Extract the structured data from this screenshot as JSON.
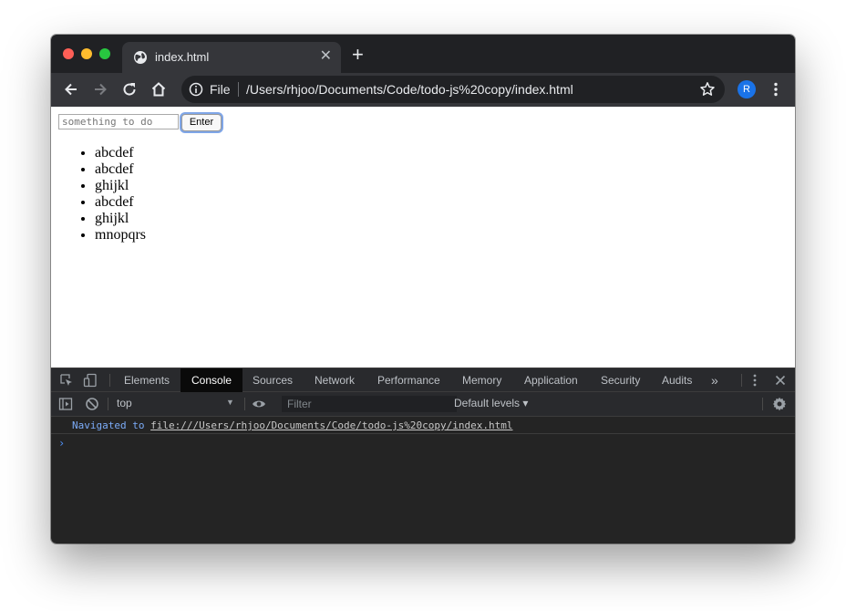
{
  "browser": {
    "tab": {
      "title": "index.html"
    },
    "omnibox": {
      "scheme_label": "File",
      "url": "/Users/rhjoo/Documents/Code/todo-js%20copy/index.html"
    },
    "profile_initial": "R"
  },
  "page": {
    "input": {
      "placeholder": "something to do",
      "value": ""
    },
    "button_label": "Enter",
    "items": [
      "abcdef",
      "abcdef",
      "ghijkl",
      "abcdef",
      "ghijkl",
      "mnopqrs"
    ]
  },
  "devtools": {
    "tabs": [
      "Elements",
      "Console",
      "Sources",
      "Network",
      "Performance",
      "Memory",
      "Application",
      "Security",
      "Audits"
    ],
    "active_tab": "Console",
    "more_tabs_label": "»",
    "context": "top",
    "filter_placeholder": "Filter",
    "levels_label": "Default levels ▾",
    "messages": {
      "navigated_text": "Navigated to",
      "navigated_url": "file:///Users/rhjoo/Documents/Code/todo-js%20copy/index.html"
    },
    "prompt": "›"
  },
  "colors": {
    "tab_strip": "#202124",
    "toolbar": "#35363a",
    "devtools_bg": "#242424",
    "accent": "#1a73e8",
    "console_link": "#7cacf8"
  }
}
